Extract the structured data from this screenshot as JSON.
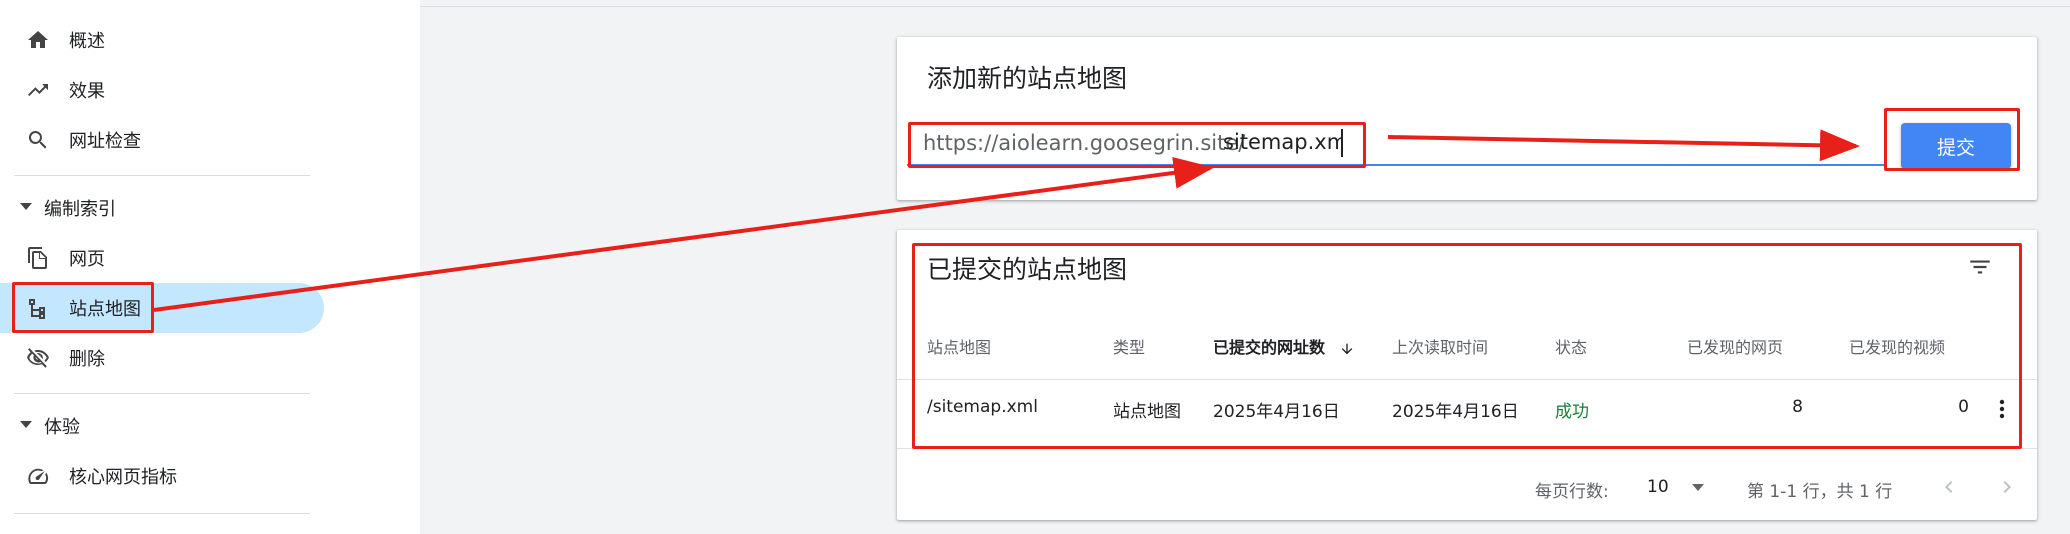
{
  "sidebar": {
    "items": [
      {
        "label": "概述",
        "icon": "home-icon"
      },
      {
        "label": "效果",
        "icon": "trending-up-icon"
      },
      {
        "label": "网址检查",
        "icon": "search-icon"
      }
    ],
    "index_section": {
      "label": "编制索引",
      "items": [
        {
          "label": "网页",
          "icon": "pages-icon"
        },
        {
          "label": "站点地图",
          "icon": "sitemap-icon",
          "active": true
        },
        {
          "label": "删除",
          "icon": "visibility-off-icon"
        }
      ]
    },
    "experience_section": {
      "label": "体验",
      "items": [
        {
          "label": "核心网页指标",
          "icon": "speed-gauge-icon"
        }
      ]
    }
  },
  "add_sitemap": {
    "title": "添加新的站点地图",
    "url_prefix": "https://aiolearn.goosegrin.site/",
    "input_value": "sitemap.xml",
    "submit_label": "提交"
  },
  "submitted": {
    "title": "已提交的站点地图",
    "columns": [
      "站点地图",
      "类型",
      "已提交的网址数",
      "上次读取时间",
      "状态",
      "已发现的网页",
      "已发现的视频"
    ],
    "sorted_column": "已提交的网址数",
    "rows": [
      {
        "sitemap": "/sitemap.xml",
        "type": "站点地图",
        "submitted_date": "2025年4月16日",
        "last_read": "2025年4月16日",
        "status": "成功",
        "pages": "8",
        "videos": "0"
      }
    ],
    "footer": {
      "rows_per_page_label": "每页行数:",
      "rows_per_page": "10",
      "range_text": "第 1-1 行，共 1 行"
    }
  },
  "colors": {
    "accent": "#4285f4",
    "active_nav": "#c2e7ff",
    "success": "#188038",
    "annotation": "#e8201a"
  }
}
